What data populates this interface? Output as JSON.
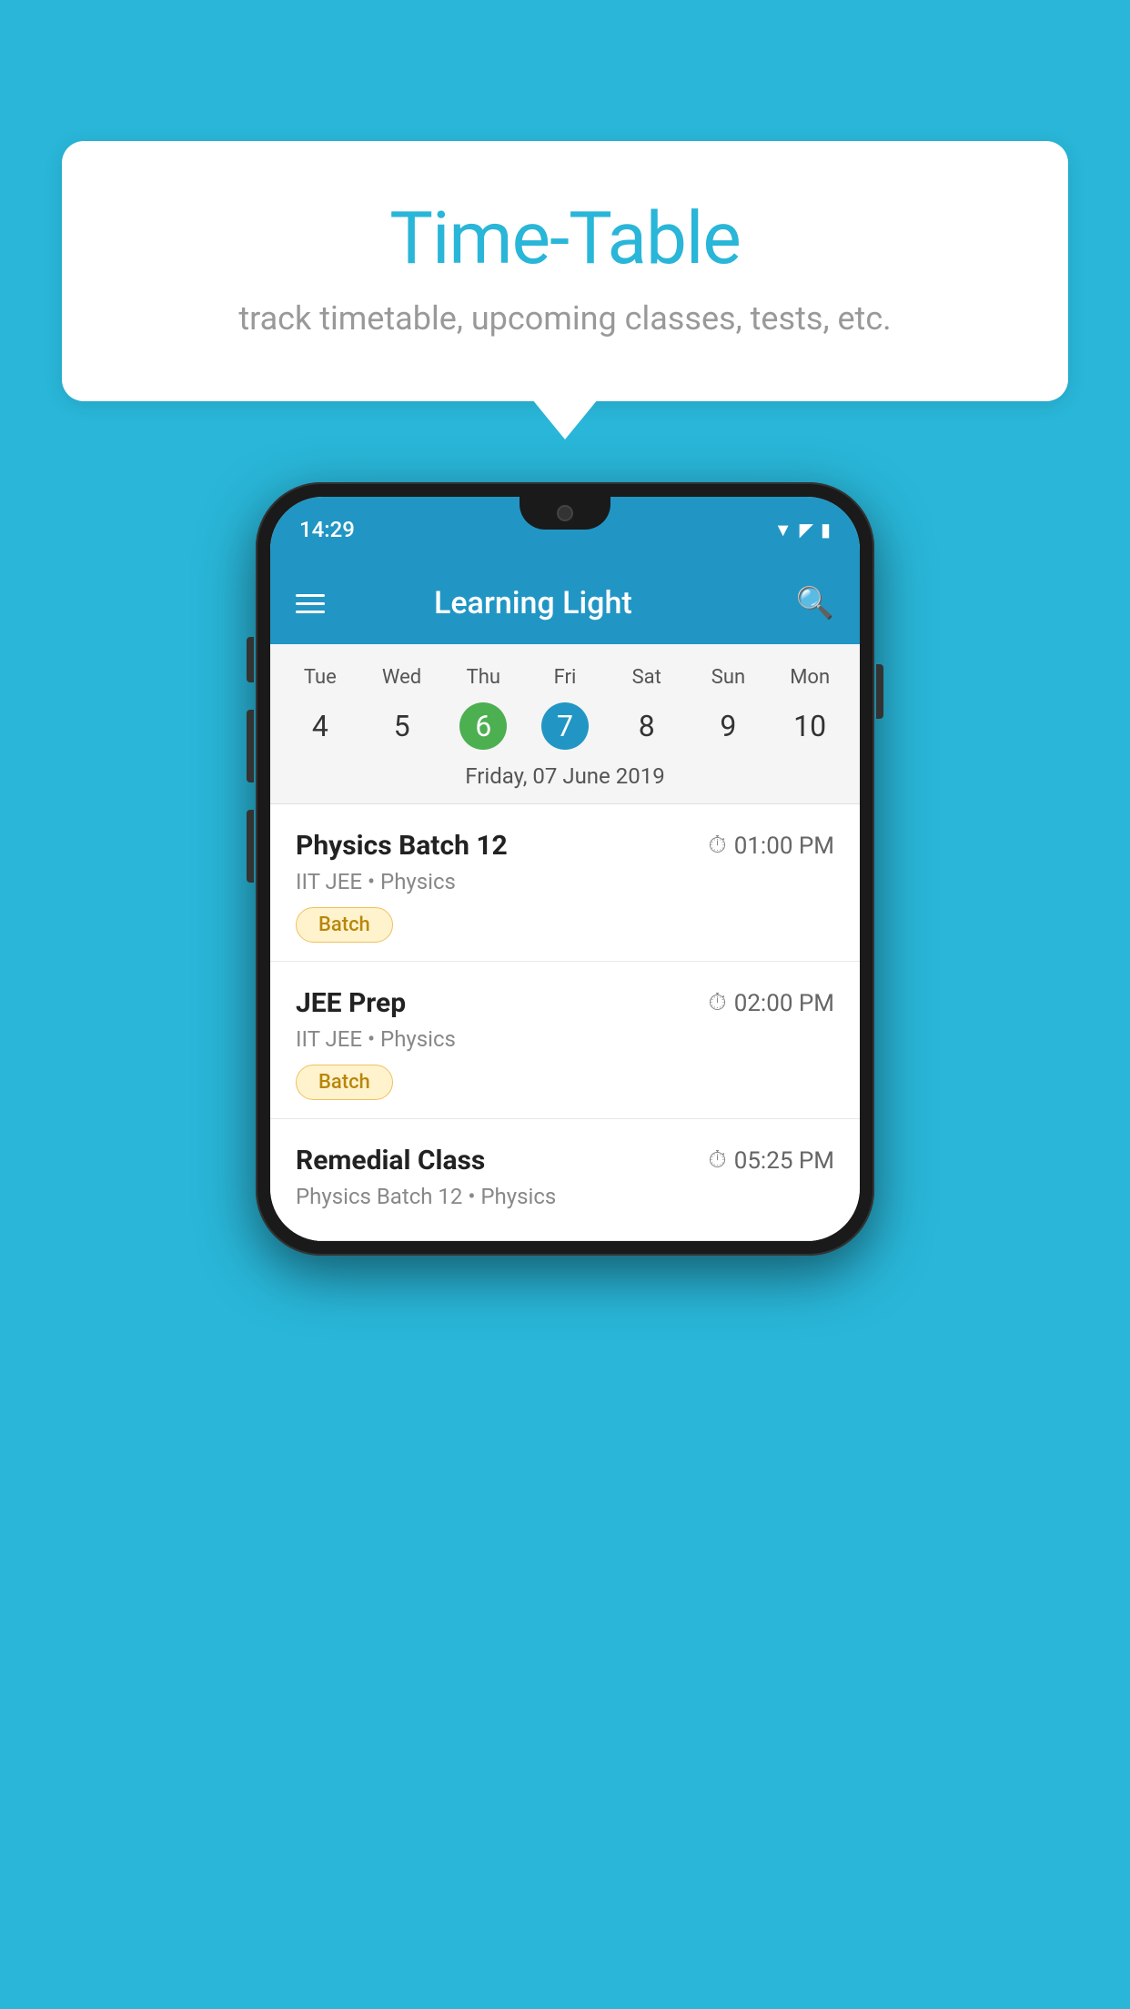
{
  "background_color": "#29b6d8",
  "bubble": {
    "title": "Time-Table",
    "subtitle": "track timetable, upcoming classes, tests, etc."
  },
  "phone": {
    "status_bar": {
      "time": "14:29"
    },
    "app_bar": {
      "title": "Learning Light"
    },
    "calendar": {
      "days": [
        "Tue",
        "Wed",
        "Thu",
        "Fri",
        "Sat",
        "Sun",
        "Mon"
      ],
      "numbers": [
        "4",
        "5",
        "6",
        "7",
        "8",
        "9",
        "10"
      ],
      "today_index": 2,
      "selected_index": 3,
      "date_label": "Friday, 07 June 2019"
    },
    "classes": [
      {
        "name": "Physics Batch 12",
        "time": "01:00 PM",
        "meta": "IIT JEE • Physics",
        "badge": "Batch"
      },
      {
        "name": "JEE Prep",
        "time": "02:00 PM",
        "meta": "IIT JEE • Physics",
        "badge": "Batch"
      },
      {
        "name": "Remedial Class",
        "time": "05:25 PM",
        "meta": "Physics Batch 12 • Physics",
        "badge": null
      }
    ]
  }
}
